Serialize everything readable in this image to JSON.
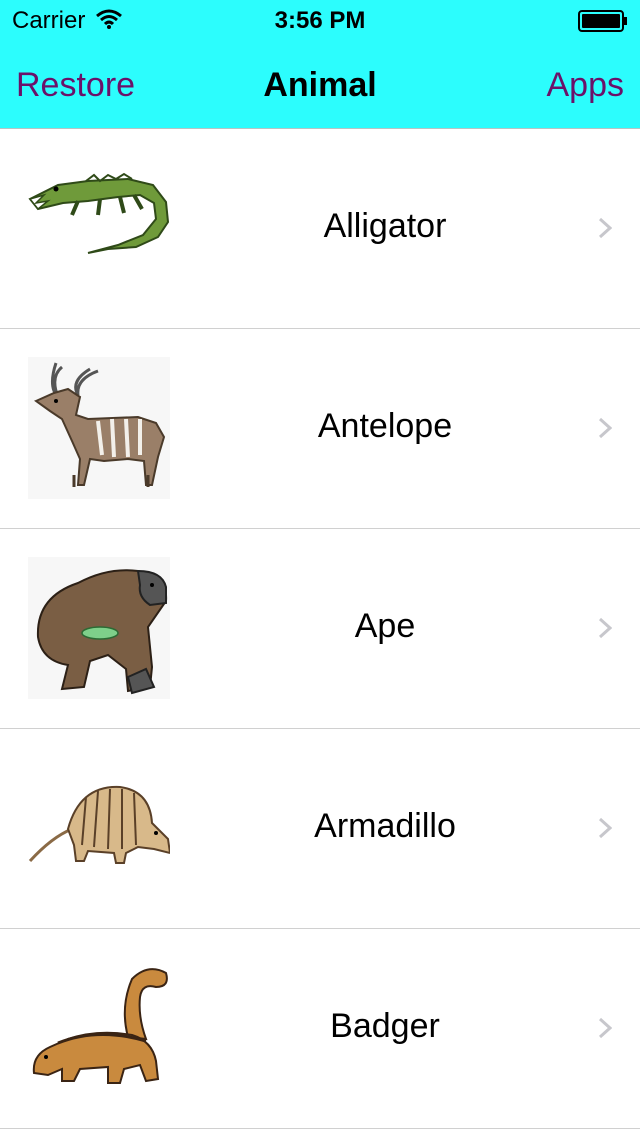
{
  "status_bar": {
    "carrier": "Carrier",
    "time": "3:56 PM",
    "wifi_icon": "wifi-icon",
    "battery_icon": "battery-icon"
  },
  "nav": {
    "left_button": "Restore",
    "title": "Animal",
    "right_button": "Apps",
    "bar_color": "#2cfdfd",
    "button_color": "#6b1169"
  },
  "animals": [
    {
      "name": "Alligator",
      "image": "alligator-image"
    },
    {
      "name": "Antelope",
      "image": "antelope-image"
    },
    {
      "name": "Ape",
      "image": "ape-image"
    },
    {
      "name": "Armadillo",
      "image": "armadillo-image"
    },
    {
      "name": "Badger",
      "image": "badger-image"
    }
  ]
}
